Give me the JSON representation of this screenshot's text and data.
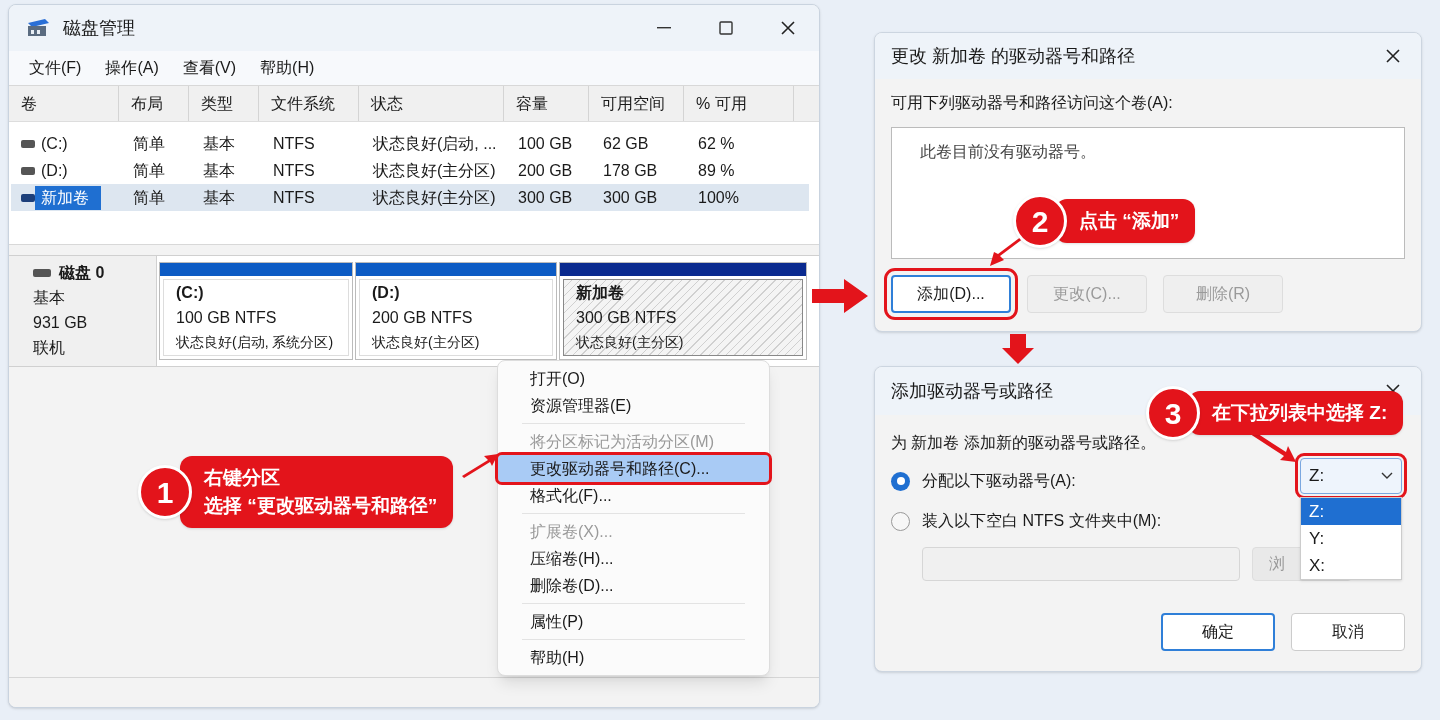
{
  "disk_management": {
    "title": "磁盘管理",
    "menu": [
      "文件(F)",
      "操作(A)",
      "查看(V)",
      "帮助(H)"
    ],
    "columns": [
      "卷",
      "布局",
      "类型",
      "文件系统",
      "状态",
      "容量",
      "可用空间",
      "% 可用"
    ],
    "rows": [
      {
        "cells": [
          "(C:)",
          "简单",
          "基本",
          "NTFS",
          "状态良好(启动, ...",
          "100 GB",
          "62 GB",
          "62 %"
        ],
        "selected": false
      },
      {
        "cells": [
          "(D:)",
          "简单",
          "基本",
          "NTFS",
          "状态良好(主分区)",
          "200 GB",
          "178 GB",
          "89 %"
        ],
        "selected": false
      },
      {
        "cells": [
          "新加卷",
          "简单",
          "基本",
          "NTFS",
          "状态良好(主分区)",
          "300 GB",
          "300 GB",
          "100%"
        ],
        "selected": true
      }
    ],
    "disk": {
      "name": "磁盘 0",
      "type": "基本",
      "size": "931 GB",
      "status": "联机"
    },
    "partitions": [
      {
        "name": "(C:)",
        "size": "100 GB NTFS",
        "status": "状态良好(启动, 系统分区)",
        "selected": false
      },
      {
        "name": "(D:)",
        "size": "200 GB NTFS",
        "status": "状态良好(主分区)",
        "selected": false
      },
      {
        "name": "新加卷",
        "size": "300 GB NTFS",
        "status": "状态良好(主分区)",
        "selected": true
      }
    ]
  },
  "context_menu": [
    {
      "kind": "item",
      "label": "打开(O)",
      "disabled": false,
      "selected": false
    },
    {
      "kind": "item",
      "label": "资源管理器(E)",
      "disabled": false,
      "selected": false
    },
    {
      "kind": "separator"
    },
    {
      "kind": "item",
      "label": "将分区标记为活动分区(M)",
      "disabled": true,
      "selected": false
    },
    {
      "kind": "item",
      "label": "更改驱动器号和路径(C)...",
      "disabled": false,
      "selected": true
    },
    {
      "kind": "item",
      "label": "格式化(F)...",
      "disabled": false,
      "selected": false
    },
    {
      "kind": "separator"
    },
    {
      "kind": "item",
      "label": "扩展卷(X)...",
      "disabled": true,
      "selected": false
    },
    {
      "kind": "item",
      "label": "压缩卷(H)...",
      "disabled": false,
      "selected": false
    },
    {
      "kind": "item",
      "label": "删除卷(D)...",
      "disabled": false,
      "selected": false
    },
    {
      "kind": "separator"
    },
    {
      "kind": "item",
      "label": "属性(P)",
      "disabled": false,
      "selected": false
    },
    {
      "kind": "separator"
    },
    {
      "kind": "item",
      "label": "帮助(H)",
      "disabled": false,
      "selected": false
    }
  ],
  "change_dialog": {
    "title": "更改 新加卷 的驱动器号和路径",
    "prompt": "可用下列驱动器号和路径访问这个卷(A):",
    "list_text": "此卷目前没有驱动器号。",
    "buttons": [
      {
        "label": "添加(D)...",
        "disabled": false
      },
      {
        "label": "更改(C)...",
        "disabled": true
      },
      {
        "label": "删除(R)",
        "disabled": true
      }
    ]
  },
  "add_dialog": {
    "title": "添加驱动器号或路径",
    "description": "为 新加卷 添加新的驱动器号或路径。",
    "options": [
      {
        "label": "分配以下驱动器号(A):",
        "selected": true
      },
      {
        "label": "装入以下空白 NTFS 文件夹中(M):",
        "selected": false
      }
    ],
    "browse_button": "浏",
    "dropdown_value": "Z:",
    "dropdown_options": [
      {
        "label": "Z:",
        "selected": true
      },
      {
        "label": "Y:",
        "selected": false
      },
      {
        "label": "X:",
        "selected": false
      }
    ],
    "buttons": [
      "确定",
      "取消"
    ]
  },
  "callouts": [
    {
      "number": "1",
      "lines": [
        "右键分区",
        "选择 “更改驱动器号和路径”"
      ]
    },
    {
      "number": "2",
      "lines": [
        "点击 “添加”"
      ]
    },
    {
      "number": "3",
      "lines": [
        "在下拉列表中选择 Z:"
      ]
    }
  ]
}
